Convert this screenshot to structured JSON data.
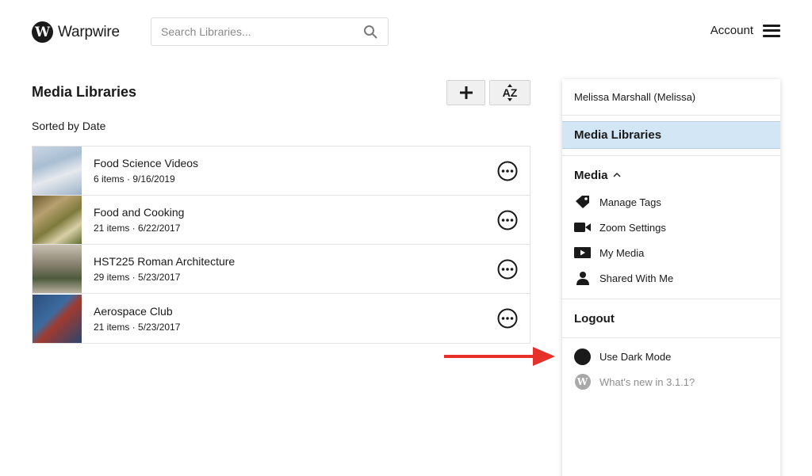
{
  "header": {
    "logo_letter": "W",
    "logo_text": "Warpwire",
    "search_placeholder": "Search Libraries...",
    "account_label": "Account"
  },
  "main": {
    "title": "Media Libraries",
    "sorted_label": "Sorted by Date",
    "add_button_glyph": "+",
    "sort_button_glyph": "AZ",
    "libraries": [
      {
        "name": "Food Science Videos",
        "meta": "6 items · 9/16/2019"
      },
      {
        "name": "Food and Cooking",
        "meta": "21 items · 6/22/2017"
      },
      {
        "name": "HST225 Roman Architecture",
        "meta": "29 items · 5/23/2017"
      },
      {
        "name": "Aerospace Club",
        "meta": "21 items · 5/23/2017"
      }
    ]
  },
  "menu": {
    "user": "Melissa Marshall (Melissa)",
    "active_item": "Media Libraries",
    "media_section": "Media",
    "media_items": [
      {
        "label": "Manage Tags",
        "icon": "tag-icon"
      },
      {
        "label": "Zoom Settings",
        "icon": "video-camera-icon"
      },
      {
        "label": "My Media",
        "icon": "play-icon"
      },
      {
        "label": "Shared With Me",
        "icon": "person-icon"
      }
    ],
    "logout": "Logout",
    "dark_mode": "Use Dark Mode",
    "whats_new": "What's new in 3.1.1?",
    "whats_new_badge": "W"
  },
  "colors": {
    "active_bg": "#d3e6f6",
    "arrow": "#e8302a",
    "text": "#1a1a1a",
    "muted": "#8e8e8e"
  }
}
